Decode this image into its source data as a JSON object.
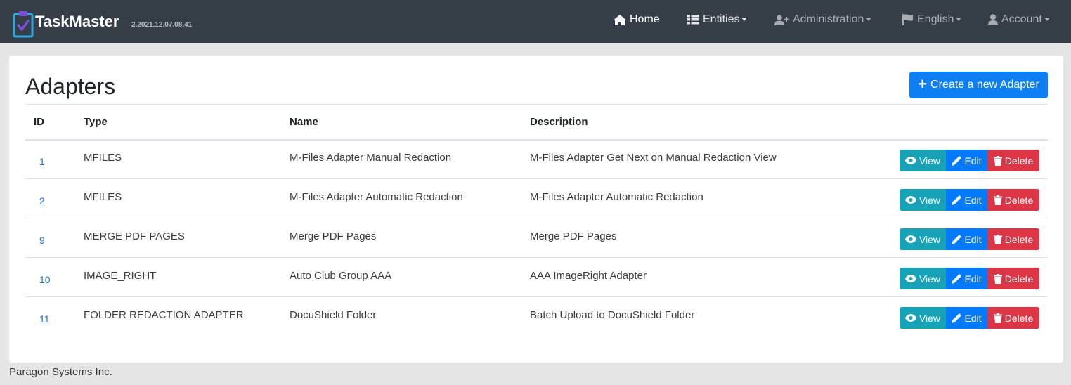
{
  "app": {
    "name": "TaskMaster",
    "version": "2.2021.12.07.08.41"
  },
  "nav": {
    "home": "Home",
    "entities": "Entities",
    "administration": "Administration",
    "language": "English",
    "account": "Account"
  },
  "page": {
    "title": "Adapters",
    "create_button": "Create a new Adapter"
  },
  "table": {
    "headers": [
      "ID",
      "Type",
      "Name",
      "Description"
    ],
    "rows": [
      {
        "id": "1",
        "type": "MFILES",
        "name": "M-Files Adapter Manual Redaction",
        "description": "M-Files Adapter Get Next on Manual Redaction View"
      },
      {
        "id": "2",
        "type": "MFILES",
        "name": "M-Files Adapter Automatic Redaction",
        "description": "M-Files Adapter Automatic Redaction"
      },
      {
        "id": "9",
        "type": "MERGE PDF PAGES",
        "name": "Merge PDF Pages",
        "description": "Merge PDF Pages"
      },
      {
        "id": "10",
        "type": "IMAGE_RIGHT",
        "name": "Auto Club Group AAA",
        "description": "AAA ImageRight Adapter"
      },
      {
        "id": "11",
        "type": "FOLDER REDACTION ADAPTER",
        "name": "DocuShield Folder",
        "description": "Batch Upload to DocuShield Folder"
      }
    ],
    "actions": {
      "view": "View",
      "edit": "Edit",
      "delete": "Delete"
    }
  },
  "footer": {
    "company": "Paragon Systems Inc."
  },
  "colors": {
    "navbar": "#353d47",
    "primary": "#0d7ef3",
    "info": "#17a2b8",
    "edit": "#007bff",
    "danger": "#dc3545",
    "link": "#1a73e8"
  },
  "icons": {
    "logo": "clipboard-check-icon",
    "home": "home-icon",
    "entities": "table-icon",
    "administration": "user-plus-icon",
    "language": "flag-icon",
    "account": "user-icon",
    "create": "plus-icon",
    "view": "eye-icon",
    "edit": "pencil-icon",
    "delete": "trash-icon"
  }
}
